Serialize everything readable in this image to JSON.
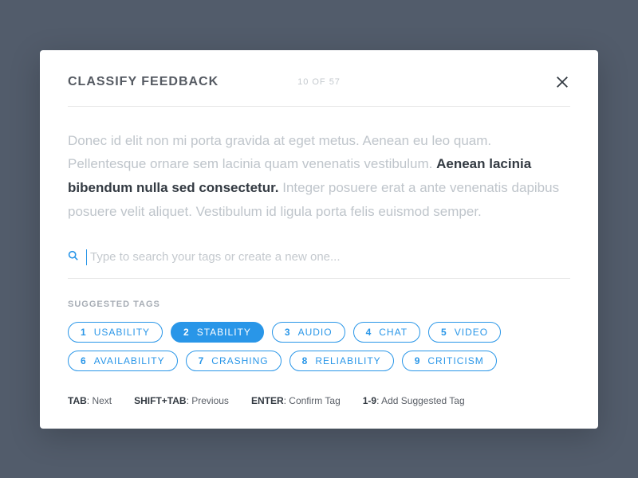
{
  "header": {
    "title": "CLASSIFY FEEDBACK",
    "counter": "10 OF 57"
  },
  "feedback": {
    "pre": "Donec id elit non mi porta gravida at eget metus. Aenean eu leo quam. Pellentesque ornare sem lacinia quam venenatis vestibulum. ",
    "emphasis": "Aenean lacinia bibendum nulla sed consectetur.",
    "post": " Integer posuere erat a ante venenatis dapibus posuere velit aliquet. Vestibulum id ligula porta felis euismod semper."
  },
  "search": {
    "placeholder": "Type to search your tags or create a new one...",
    "value": ""
  },
  "suggested": {
    "label": "SUGGESTED TAGS",
    "tags": [
      {
        "num": "1",
        "label": "USABILITY",
        "selected": false
      },
      {
        "num": "2",
        "label": "STABILITY",
        "selected": true
      },
      {
        "num": "3",
        "label": "AUDIO",
        "selected": false
      },
      {
        "num": "4",
        "label": "CHAT",
        "selected": false
      },
      {
        "num": "5",
        "label": "VIDEO",
        "selected": false
      },
      {
        "num": "6",
        "label": "AVAILABILITY",
        "selected": false
      },
      {
        "num": "7",
        "label": "CRASHING",
        "selected": false
      },
      {
        "num": "8",
        "label": "RELIABILITY",
        "selected": false
      },
      {
        "num": "9",
        "label": "CRITICISM",
        "selected": false
      }
    ]
  },
  "shortcuts": [
    {
      "key": "TAB",
      "desc": ": Next"
    },
    {
      "key": "SHIFT+TAB",
      "desc": ": Previous"
    },
    {
      "key": "ENTER",
      "desc": ": Confirm Tag"
    },
    {
      "key": "1-9",
      "desc": ": Add Suggested Tag"
    }
  ]
}
